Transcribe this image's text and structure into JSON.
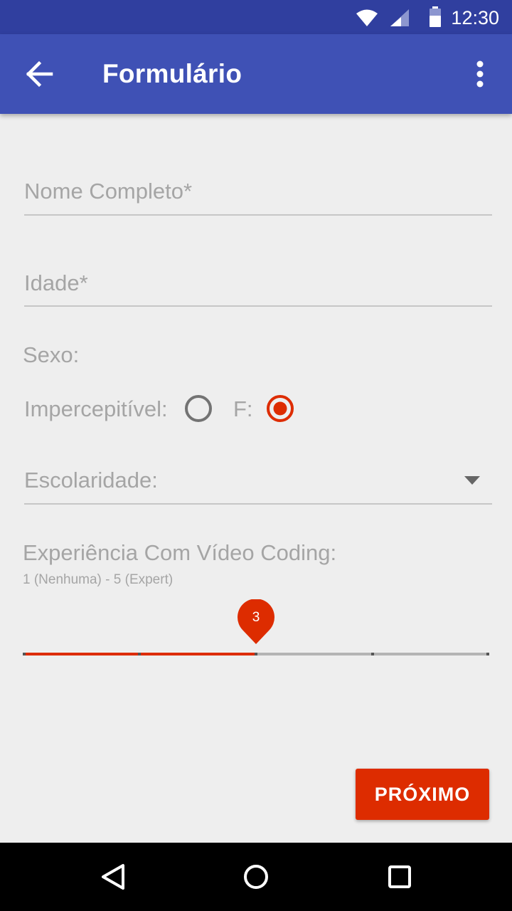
{
  "status_bar": {
    "time": "12:30",
    "icons": [
      "wifi-icon",
      "signal-icon",
      "battery-icon"
    ]
  },
  "app_bar": {
    "title": "Formulário",
    "back_icon": "arrow-back-icon",
    "menu_icon": "more-vert-icon"
  },
  "form": {
    "name_placeholder": "Nome Completo*",
    "age_placeholder": "Idade*",
    "sex_label": "Sexo:",
    "option_a_label": "Impercepitível:",
    "option_b_label": "F:",
    "selected_option": "F",
    "schooling_label": "Escolaridade:",
    "experience_label": "Experiência Com Vídeo Coding:",
    "experience_hint": "1 (Nenhuma) - 5 (Expert)",
    "experience": {
      "min": 1,
      "max": 5,
      "value": 3,
      "value_label": "3"
    }
  },
  "next_button_label": "PRÓXIMO",
  "nav_bar": {
    "icons": [
      "back-triangle-icon",
      "home-circle-icon",
      "recents-square-icon"
    ]
  },
  "colors": {
    "primary": "#3f51b5",
    "primary_dark": "#303f9f",
    "accent": "#dd2c00",
    "background": "#eeeeee",
    "hint_text": "#a5a5a5"
  }
}
